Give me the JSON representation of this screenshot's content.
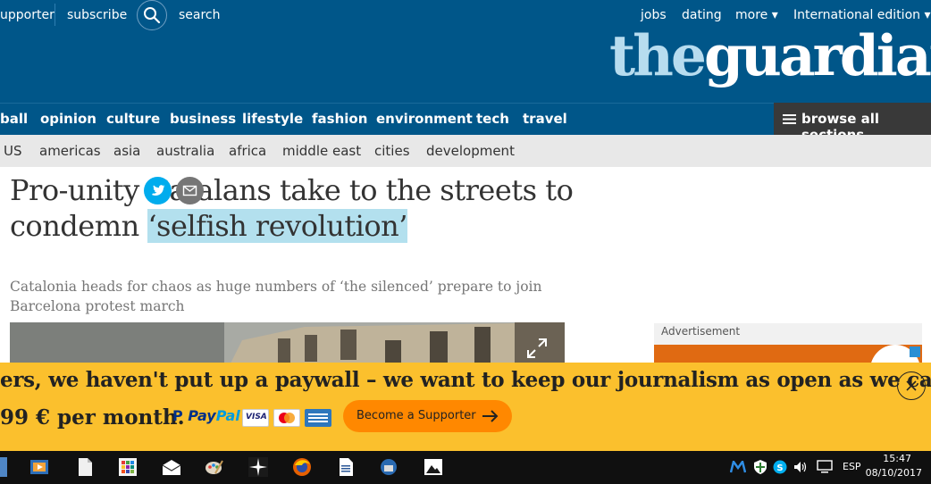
{
  "top": {
    "links_left": [
      "upporter",
      "subscribe",
      "search"
    ],
    "links_right": [
      "jobs",
      "dating",
      "more ▾",
      "International edition ▾"
    ],
    "logo_the": "the",
    "logo_guardian": "guardian"
  },
  "nav": {
    "items": [
      "ball",
      "opinion",
      "culture",
      "business",
      "lifestyle",
      "fashion",
      "environment",
      "tech",
      "travel"
    ],
    "browse": "browse all sections"
  },
  "subnav": {
    "items": [
      "US",
      "americas",
      "asia",
      "australia",
      "africa",
      "middle east",
      "cities",
      "development"
    ]
  },
  "article": {
    "headline_part1": "Pro-unity Catalans take to the streets to condemn ",
    "headline_highlight": "‘selfish revolution’",
    "standfirst": "Catalonia heads for chaos as huge numbers of ‘the silenced’ prepare to join Barcelona protest march"
  },
  "advert": {
    "label": "Advertisement"
  },
  "banner": {
    "line1": "ers, we haven't put up a paywall – we want to keep our journalism as open as we can.",
    "line2": "99 € per month.",
    "paypal_a": "Pay",
    "paypal_b": "Pal",
    "cards": [
      "VISA",
      "mastercard",
      "AMEX"
    ],
    "button": "Become a Supporter"
  },
  "taskbar": {
    "lang": "ESP",
    "time": "15:47",
    "date": "08/10/2017"
  },
  "colors": {
    "brand_blue": "#005689",
    "highlight": "#b3e0ee",
    "banner_yellow": "#fbc02d",
    "button_orange": "#ff8800"
  }
}
